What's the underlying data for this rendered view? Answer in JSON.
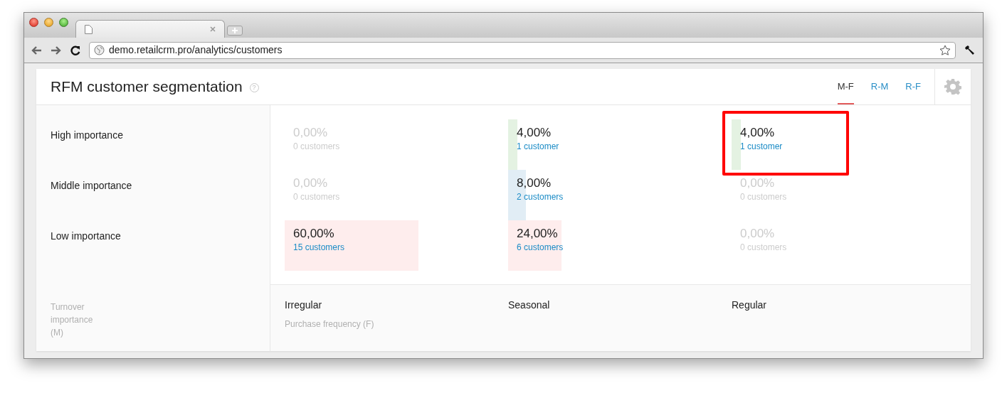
{
  "browser": {
    "url": "demo.retailcrm.pro/analytics/customers"
  },
  "header": {
    "title": "RFM customer segmentation",
    "help_icon": "?",
    "tabs": [
      {
        "label": "M-F",
        "selected": true
      },
      {
        "label": "R-M",
        "selected": false
      },
      {
        "label": "R-F",
        "selected": false
      }
    ]
  },
  "rows": [
    {
      "label": "High importance",
      "color": "#e4f2e2",
      "cells": [
        {
          "percent": "0,00%",
          "count": "0 customers",
          "highlighted": false
        },
        {
          "percent": "4,00%",
          "count": "1 customer",
          "highlighted": false
        },
        {
          "percent": "4,00%",
          "count": "1 customer",
          "highlighted": true
        }
      ]
    },
    {
      "label": "Middle importance",
      "color": "#e1edf5",
      "cells": [
        {
          "percent": "0,00%",
          "count": "0 customers",
          "highlighted": false
        },
        {
          "percent": "8,00%",
          "count": "2 customers",
          "highlighted": false
        },
        {
          "percent": "0,00%",
          "count": "0 customers",
          "highlighted": false
        }
      ]
    },
    {
      "label": "Low importance",
      "color": "#feeded",
      "cells": [
        {
          "percent": "60,00%",
          "count": "15 customers",
          "highlighted": false
        },
        {
          "percent": "24,00%",
          "count": "6 customers",
          "highlighted": false
        },
        {
          "percent": "0,00%",
          "count": "0 customers",
          "highlighted": false
        }
      ]
    }
  ],
  "y_axis_label": "Turnover importance (M)",
  "columns": [
    "Irregular",
    "Seasonal",
    "Regular"
  ],
  "x_axis_label": "Purchase frequency (F)"
}
